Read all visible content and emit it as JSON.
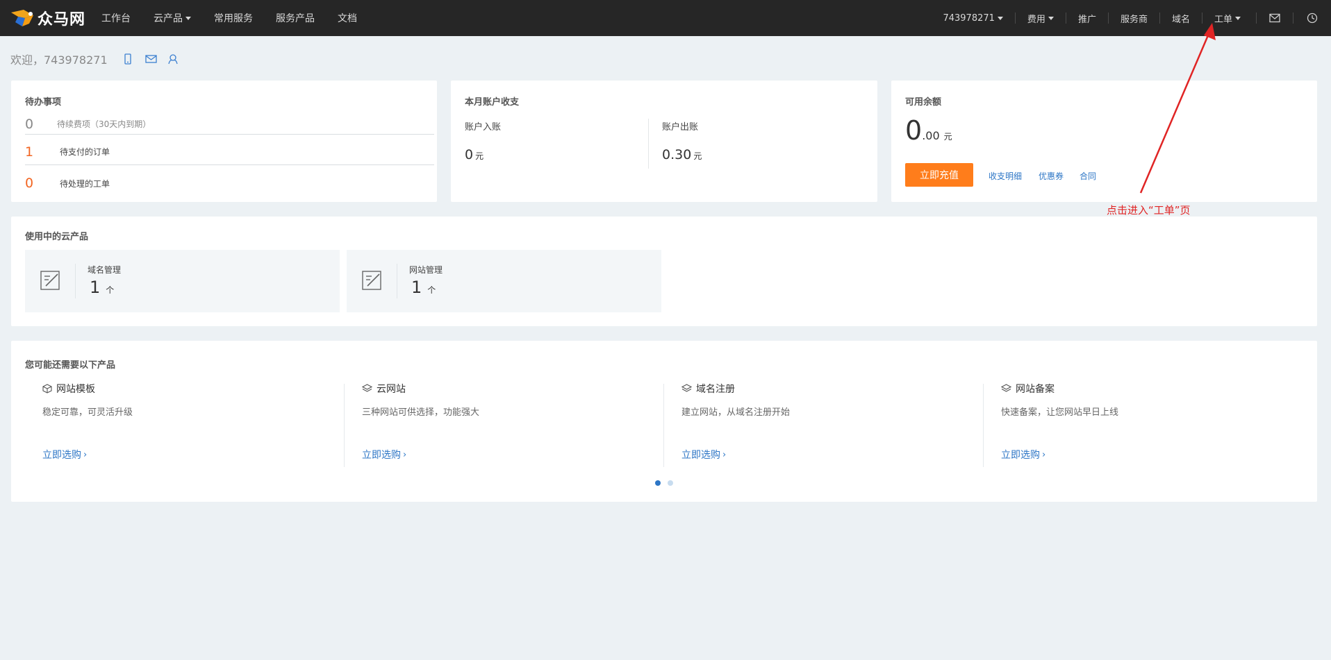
{
  "topbar": {
    "logo_text": "众马网",
    "nav": [
      "工作台",
      "云产品",
      "常用服务",
      "服务产品",
      "文档"
    ],
    "account": "743978271",
    "fees": "费用",
    "promote": "推广",
    "provider": "服务商",
    "domain": "域名",
    "ticket": "工单"
  },
  "welcome": {
    "text": "欢迎，743978271"
  },
  "todo": {
    "title": "待办事项",
    "renew_num": "0",
    "renew_label": "待续费项（30天内到期）",
    "unpaid_num": "1",
    "unpaid_label": "待支付的订单",
    "pending_num": "0",
    "pending_label": "待处理的工单"
  },
  "monthly": {
    "title": "本月账户收支",
    "in_label": "账户入账",
    "in_value": "0",
    "out_label": "账户出账",
    "out_value": "0.30",
    "unit": "元"
  },
  "balance": {
    "title": "可用余额",
    "int": "0",
    "dec": ".00",
    "unit": "元",
    "recharge": "立即充值",
    "detail": "收支明细",
    "coupon": "优惠券",
    "contract": "合同"
  },
  "in_use": {
    "title": "使用中的云产品",
    "items": [
      {
        "name": "域名管理",
        "count": "1",
        "unit": "个"
      },
      {
        "name": "网站管理",
        "count": "1",
        "unit": "个"
      }
    ]
  },
  "recommend": {
    "title": "您可能还需要以下产品",
    "items": [
      {
        "name": "网站模板",
        "desc": "稳定可靠，可灵活升级",
        "link": "立即选购"
      },
      {
        "name": "云网站",
        "desc": "三种网站可供选择，功能强大",
        "link": "立即选购"
      },
      {
        "name": "域名注册",
        "desc": "建立网站，从域名注册开始",
        "link": "立即选购"
      },
      {
        "name": "网站备案",
        "desc": "快速备案，让您网站早日上线",
        "link": "立即选购"
      }
    ]
  },
  "annotation": "点击进入“工单”页",
  "colors": {
    "accent": "#ff7d1b",
    "link": "#2d76c6",
    "annotation": "#e02424",
    "topbar": "#262626"
  }
}
